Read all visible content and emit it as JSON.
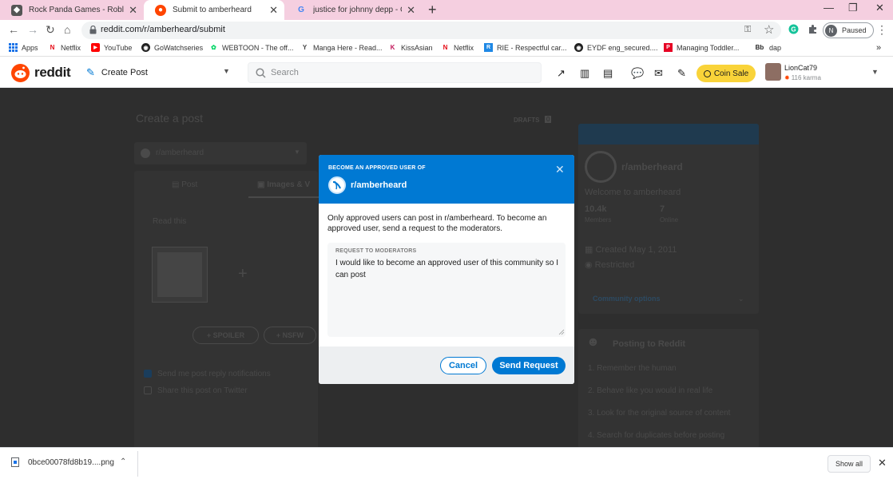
{
  "browser": {
    "tabs": [
      {
        "title": "Rock Panda Games - Roblox",
        "icon": "roblox-icon"
      },
      {
        "title": "Submit to amberheard",
        "icon": "reddit-icon"
      },
      {
        "title": "justice for johnny depp - Google",
        "icon": "google-icon"
      }
    ],
    "url": "reddit.com/r/amberheard/submit",
    "profile_initial": "N",
    "profile_status": "Paused",
    "bookmarks": [
      {
        "label": "Apps",
        "icon": "apps-grid-icon"
      },
      {
        "label": "Netflix",
        "icon": "netflix-icon"
      },
      {
        "label": "YouTube",
        "icon": "youtube-icon"
      },
      {
        "label": "GoWatchseries",
        "icon": "gowatchseries-icon"
      },
      {
        "label": "WEBTOON - The off...",
        "icon": "webtoon-icon"
      },
      {
        "label": "Manga Here - Read...",
        "icon": "mangahere-icon"
      },
      {
        "label": "KissAsian",
        "icon": "kissasian-icon"
      },
      {
        "label": "Netflix",
        "icon": "netflix-icon"
      },
      {
        "label": "RIE - Respectful car...",
        "icon": "rie-icon"
      },
      {
        "label": "EYDF eng_secured....",
        "icon": "eydf-icon"
      },
      {
        "label": "Managing Toddler...",
        "icon": "pinterest-icon"
      },
      {
        "label": "dap",
        "icon": "bb-icon"
      }
    ],
    "bookmarks_overflow": "»"
  },
  "reddit_header": {
    "brand": "reddit",
    "create_post": "Create Post",
    "search_placeholder": "Search",
    "coin_sale": "Coin Sale",
    "username": "LionCat79",
    "karma": "116 karma"
  },
  "background": {
    "page_title": "Create a post",
    "drafts_label": "DRAFTS",
    "drafts_count": "0",
    "community_selector": "r/amberheard",
    "tab_post": "Post",
    "tab_images": "Images & V",
    "read_this": "Read this",
    "spoiler": "SPOILER",
    "nsfw": "NSFW",
    "notify": "Send me post reply notifications",
    "share_twitter": "Share this post on Twitter",
    "sidebar": {
      "name": "r/amberheard",
      "welcome": "Welcome to amberheard",
      "members_count": "10.4k",
      "members_label": "Members",
      "online_count": "7",
      "online_label": "Online",
      "created": "Created May 1, 2011",
      "restricted": "Restricted",
      "community_options": "Community options",
      "posting_title": "Posting to Reddit",
      "rules": [
        "1. Remember the human",
        "2. Behave like you would in real life",
        "3. Look for the original source of content",
        "4. Search for duplicates before posting"
      ]
    }
  },
  "modal": {
    "kicker": "BECOME AN APPROVED USER OF",
    "subreddit": "r/amberheard",
    "description": "Only approved users can post in r/amberheard. To become an approved user, send a request to the moderators.",
    "textarea_label": "REQUEST TO MODERATORS",
    "textarea_value": "I would like to become an approved user of this community so I can post",
    "cancel": "Cancel",
    "send": "Send Request",
    "accent_color": "#0079d3"
  },
  "downloads": {
    "file_name": "0bce00078fd8b19....png",
    "show_all": "Show all"
  }
}
